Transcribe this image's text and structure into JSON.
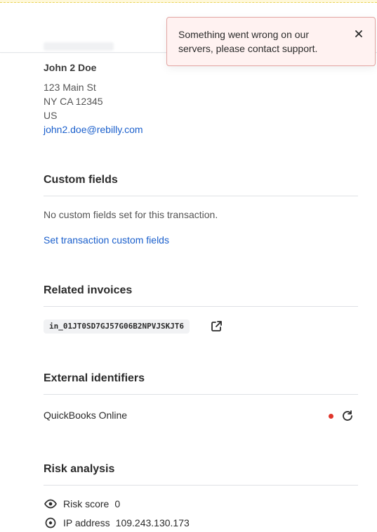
{
  "customer": {
    "name": "John 2 Doe",
    "address_line1": "123 Main St",
    "address_line2": "NY CA 12345",
    "country": "US",
    "email": "john2.doe@rebilly.com"
  },
  "custom_fields": {
    "title": "Custom fields",
    "empty_text": "No custom fields set for this transaction.",
    "set_link": "Set transaction custom fields"
  },
  "related_invoices": {
    "title": "Related invoices",
    "invoice_id": "in_01JT0SD7GJ57G06B2NPVJSKJT6"
  },
  "external_identifiers": {
    "title": "External identifiers",
    "items": [
      {
        "label": "QuickBooks Online",
        "status_color": "#e0352b"
      }
    ]
  },
  "risk_analysis": {
    "title": "Risk analysis",
    "rows": [
      {
        "label": "Risk score",
        "value": "0",
        "icon": "eye-icon"
      },
      {
        "label": "IP address",
        "value": "109.243.130.173",
        "icon": "location-icon"
      }
    ]
  },
  "toast": {
    "message": "Something went wrong on our servers, please contact support."
  },
  "colors": {
    "link": "#1a5fcc",
    "error_bg": "#fff2f1",
    "error_border": "#e2a4a1"
  }
}
